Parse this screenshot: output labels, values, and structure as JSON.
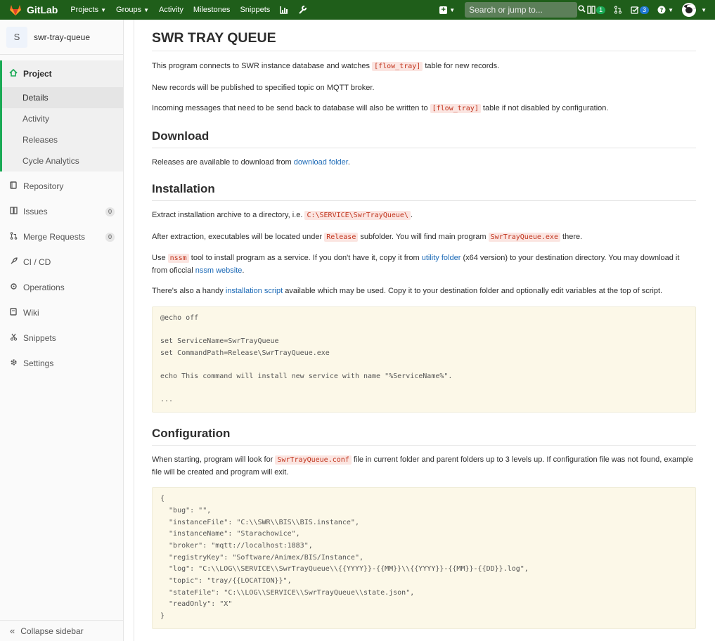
{
  "nav": {
    "brand": "GitLab",
    "links": {
      "projects": "Projects",
      "groups": "Groups",
      "activity": "Activity",
      "milestones": "Milestones",
      "snippets": "Snippets"
    },
    "search_placeholder": "Search or jump to...",
    "todo_count": "1",
    "issues_count": "3"
  },
  "sidebar": {
    "project_initial": "S",
    "project_name": "swr-tray-queue",
    "project_label": "Project",
    "project_subitems": [
      "Details",
      "Activity",
      "Releases",
      "Cycle Analytics"
    ],
    "items": {
      "repository": "Repository",
      "issues": "Issues",
      "issues_count": "0",
      "merge_requests": "Merge Requests",
      "merge_requests_count": "0",
      "cicd": "CI / CD",
      "operations": "Operations",
      "wiki": "Wiki",
      "snippets": "Snippets",
      "settings": "Settings"
    },
    "collapse": "Collapse sidebar"
  },
  "readme": {
    "title": "SWR TRAY QUEUE",
    "intro1_pre": "This program connects to SWR instance database and watches ",
    "intro1_code": "[flow_tray]",
    "intro1_post": " table for new records.",
    "intro2": "New records will be published to specified topic on MQTT broker.",
    "intro3_pre": "Incoming messages that need to be send back to database will also be written to ",
    "intro3_code": "[flow_tray]",
    "intro3_post": " table if not disabled by configuration.",
    "download_heading": "Download",
    "download_pre": "Releases are available to download from ",
    "download_link": "download folder",
    "download_post": ".",
    "install_heading": "Installation",
    "install1_pre": "Extract installation archive to a directory, i.e. ",
    "install1_code": "C:\\SERVICE\\SwrTrayQueue\\",
    "install1_post": ".",
    "install2_pre": "After extraction, executables will be located under ",
    "install2_code1": "Release",
    "install2_mid": " subfolder. You will find main program ",
    "install2_code2": "SwrTrayQueue.exe",
    "install2_post": " there.",
    "install3_pre": "Use ",
    "install3_code": "nssm",
    "install3_mid1": " tool to install program as a service. If you don't have it, copy it from ",
    "install3_link1": "utility folder",
    "install3_mid2": " (x64 version) to your destination directory. You may download it from oficcial ",
    "install3_link2": "nssm website",
    "install3_post": ".",
    "install4_pre": "There's also a handy ",
    "install4_link": "installation script",
    "install4_post": " available which may be used. Copy it to your destination folder and optionally edit variables at the top of script.",
    "script_lines": [
      "@echo off",
      "",
      "set ServiceName=SwrTrayQueue",
      "set CommandPath=Release\\SwrTrayQueue.exe",
      "",
      "echo This command will install new service with name \"%ServiceName%\".",
      "",
      "..."
    ],
    "config_heading": "Configuration",
    "config1_pre": "When starting, program will look for ",
    "config1_code": "SwrTrayQueue.conf",
    "config1_post": " file in current folder and parent folders up to 3 levels up. If configuration file was not found, example file will be created and program will exit.",
    "config_lines": [
      "{",
      "  \"bug\": \"\",",
      "  \"instanceFile\": \"C:\\\\SWR\\\\BIS\\\\BIS.instance\",",
      "  \"instanceName\": \"Starachowice\",",
      "  \"broker\": \"mqtt://localhost:1883\",",
      "  \"registryKey\": \"Software/Animex/BIS/Instance\",",
      "  \"log\": \"C:\\\\LOG\\\\SERVICE\\\\SwrTrayQueue\\\\{{YYYY}}-{{MM}}\\\\{{YYYY}}-{{MM}}-{{DD}}.log\",",
      "  \"topic\": \"tray/{{LOCATION}}\",",
      "  \"stateFile\": \"C:\\\\LOG\\\\SERVICE\\\\SwrTrayQueue\\\\state.json\",",
      "  \"readOnly\": \"X\"",
      "}"
    ]
  }
}
